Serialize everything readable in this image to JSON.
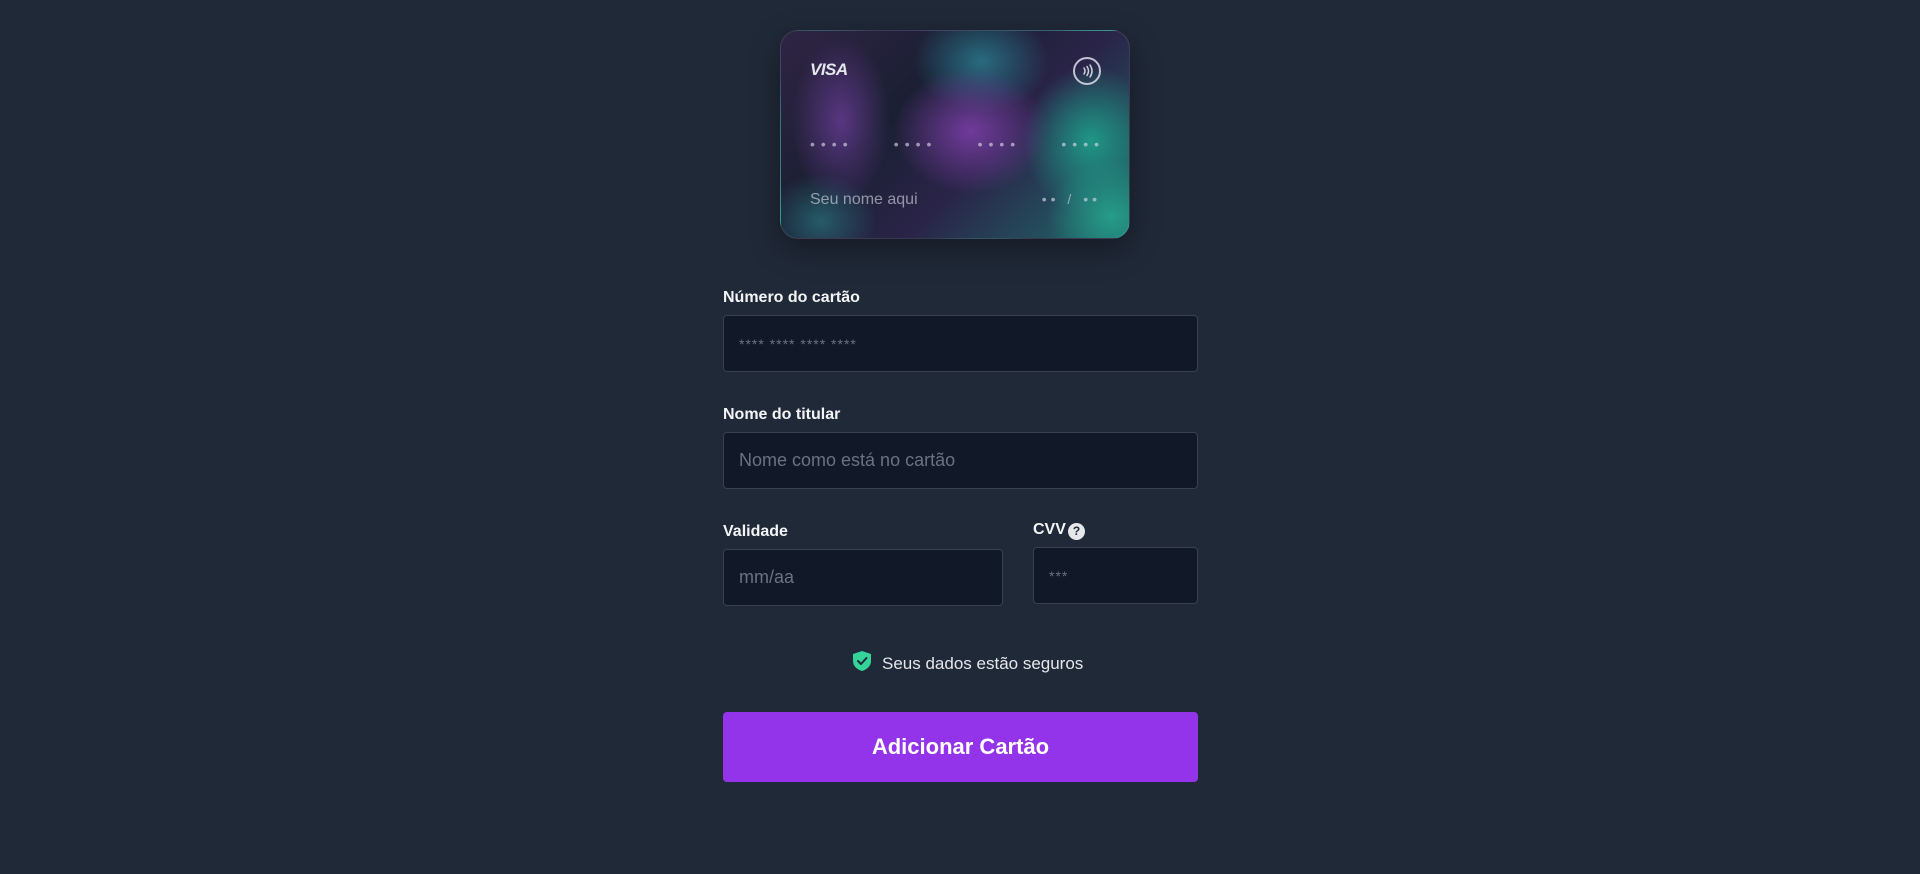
{
  "card_preview": {
    "brand": "VISA",
    "number_groups": [
      "••••",
      "••••",
      "••••",
      "••••"
    ],
    "holder_placeholder": "Seu nome aqui",
    "expiry_placeholder": "•• / ••"
  },
  "form": {
    "card_number": {
      "label": "Número do cartão",
      "placeholder": "**** **** **** ****",
      "value": ""
    },
    "holder_name": {
      "label": "Nome do titular",
      "placeholder": "Nome como está no cartão",
      "value": ""
    },
    "expiry": {
      "label": "Validade",
      "placeholder": "mm/aa",
      "value": ""
    },
    "cvv": {
      "label": "CVV",
      "help_symbol": "?",
      "placeholder": "***",
      "value": ""
    }
  },
  "security_note": {
    "text": "Seus dados estão seguros",
    "icon": "shield-check-icon",
    "icon_color": "#34d399"
  },
  "submit": {
    "label": "Adicionar Cartão",
    "color": "#9333ea"
  },
  "colors": {
    "background": "#202938",
    "input_background": "#111827",
    "input_border": "#374151"
  }
}
